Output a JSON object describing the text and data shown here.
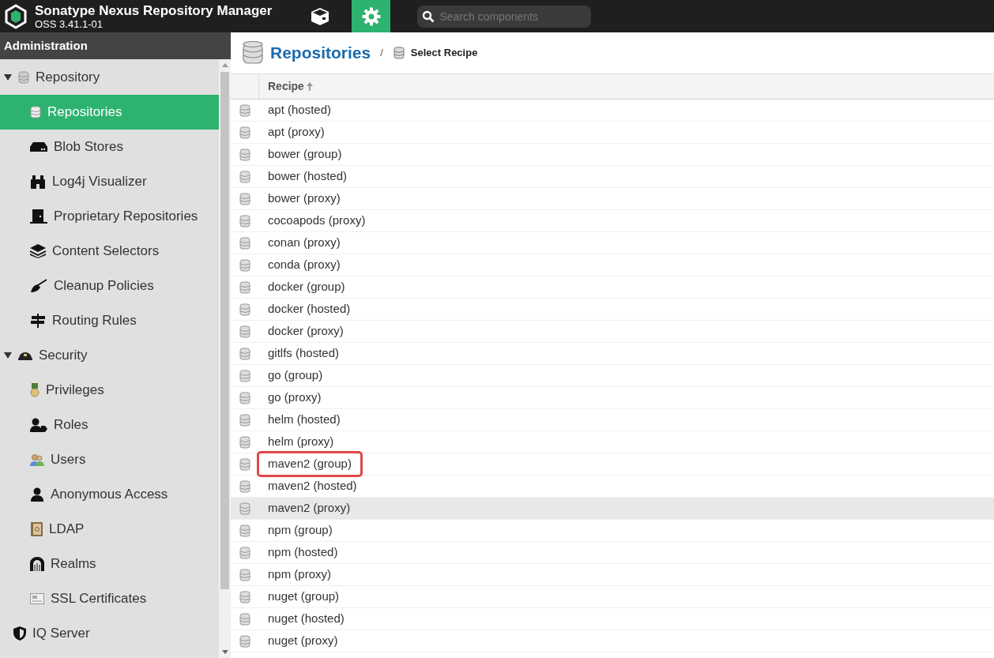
{
  "header": {
    "title": "Sonatype Nexus Repository Manager",
    "version": "OSS 3.41.1-01",
    "modes": [
      {
        "selected": false
      },
      {
        "selected": true
      }
    ],
    "search": {
      "placeholder": "Search components"
    }
  },
  "sidebar": {
    "title": "Administration",
    "items": [
      {
        "label": "Repository",
        "expanded": true,
        "selected": false,
        "children": [
          {
            "label": "Repositories",
            "selected": true
          },
          {
            "label": "Blob Stores",
            "selected": false
          },
          {
            "label": "Log4j Visualizer",
            "selected": false
          },
          {
            "label": "Proprietary Repositories",
            "selected": false
          },
          {
            "label": "Content Selectors",
            "selected": false
          },
          {
            "label": "Cleanup Policies",
            "selected": false
          },
          {
            "label": "Routing Rules",
            "selected": false
          }
        ]
      },
      {
        "label": "Security",
        "expanded": true,
        "selected": false,
        "children": [
          {
            "label": "Privileges",
            "selected": false
          },
          {
            "label": "Roles",
            "selected": false
          },
          {
            "label": "Users",
            "selected": false
          },
          {
            "label": "Anonymous Access",
            "selected": false
          },
          {
            "label": "LDAP",
            "selected": false
          },
          {
            "label": "Realms",
            "selected": false
          },
          {
            "label": "SSL Certificates",
            "selected": false
          }
        ]
      },
      {
        "label": "IQ Server",
        "selected": false
      }
    ]
  },
  "breadcrumb": {
    "title": "Repositories",
    "separator": "/",
    "current": "Select Recipe"
  },
  "table": {
    "columns": [
      {
        "label": "Recipe",
        "sorted_ascending": true
      }
    ],
    "rows": [
      {
        "recipe": "apt (hosted)",
        "hovered": false,
        "highlighted": false
      },
      {
        "recipe": "apt (proxy)",
        "hovered": false,
        "highlighted": false
      },
      {
        "recipe": "bower (group)",
        "hovered": false,
        "highlighted": false
      },
      {
        "recipe": "bower (hosted)",
        "hovered": false,
        "highlighted": false
      },
      {
        "recipe": "bower (proxy)",
        "hovered": false,
        "highlighted": false
      },
      {
        "recipe": "cocoapods (proxy)",
        "hovered": false,
        "highlighted": false
      },
      {
        "recipe": "conan (proxy)",
        "hovered": false,
        "highlighted": false
      },
      {
        "recipe": "conda (proxy)",
        "hovered": false,
        "highlighted": false
      },
      {
        "recipe": "docker (group)",
        "hovered": false,
        "highlighted": false
      },
      {
        "recipe": "docker (hosted)",
        "hovered": false,
        "highlighted": false
      },
      {
        "recipe": "docker (proxy)",
        "hovered": false,
        "highlighted": false
      },
      {
        "recipe": "gitlfs (hosted)",
        "hovered": false,
        "highlighted": false
      },
      {
        "recipe": "go (group)",
        "hovered": false,
        "highlighted": false
      },
      {
        "recipe": "go (proxy)",
        "hovered": false,
        "highlighted": false
      },
      {
        "recipe": "helm (hosted)",
        "hovered": false,
        "highlighted": false
      },
      {
        "recipe": "helm (proxy)",
        "hovered": false,
        "highlighted": false
      },
      {
        "recipe": "maven2 (group)",
        "hovered": false,
        "highlighted": true
      },
      {
        "recipe": "maven2 (hosted)",
        "hovered": false,
        "highlighted": false
      },
      {
        "recipe": "maven2 (proxy)",
        "hovered": true,
        "highlighted": false
      },
      {
        "recipe": "npm (group)",
        "hovered": false,
        "highlighted": false
      },
      {
        "recipe": "npm (hosted)",
        "hovered": false,
        "highlighted": false
      },
      {
        "recipe": "npm (proxy)",
        "hovered": false,
        "highlighted": false
      },
      {
        "recipe": "nuget (group)",
        "hovered": false,
        "highlighted": false
      },
      {
        "recipe": "nuget (hosted)",
        "hovered": false,
        "highlighted": false
      },
      {
        "recipe": "nuget (proxy)",
        "hovered": false,
        "highlighted": false
      }
    ]
  }
}
